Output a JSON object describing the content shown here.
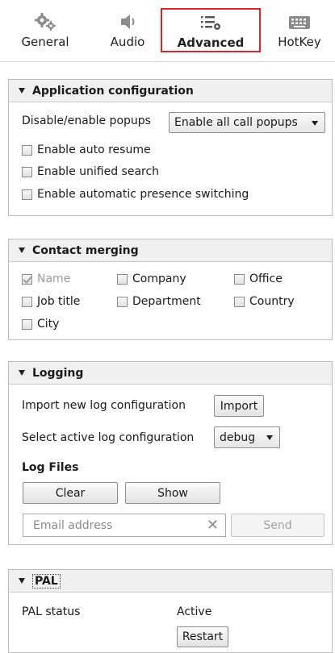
{
  "tabs": {
    "general": "General",
    "audio": "Audio",
    "advanced": "Advanced",
    "hotkey": "HotKey"
  },
  "app_config": {
    "title": "Application configuration",
    "popups_label": "Disable/enable popups",
    "popups_value": "Enable all call popups",
    "auto_resume": "Enable auto resume",
    "unified_search": "Enable unified search",
    "presence_switching": "Enable automatic presence switching"
  },
  "contact_merging": {
    "title": "Contact merging",
    "name": "Name",
    "company": "Company",
    "office": "Office",
    "job_title": "Job title",
    "department": "Department",
    "country": "Country",
    "city": "City"
  },
  "logging": {
    "title": "Logging",
    "import_label": "Import new log configuration",
    "import_button": "Import",
    "select_label": "Select active log configuration",
    "select_value": "debug",
    "log_files": "Log Files",
    "clear_button": "Clear",
    "show_button": "Show",
    "email_placeholder": "Email address",
    "send_button": "Send"
  },
  "pal": {
    "title": "PAL",
    "status_label": "PAL status",
    "status_value": "Active",
    "restart_button": "Restart"
  }
}
